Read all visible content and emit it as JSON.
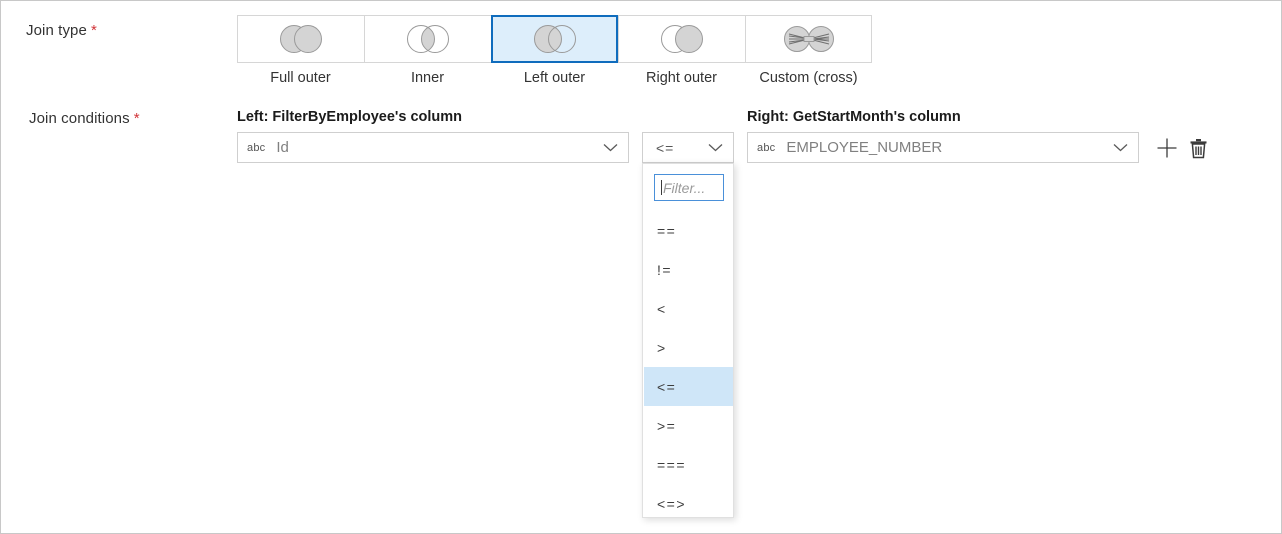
{
  "form": {
    "join_type": {
      "label": "Join type",
      "required_marker": "*",
      "options": [
        {
          "label": "Full outer",
          "icon": "venn-full-outer-icon",
          "selected": false
        },
        {
          "label": "Inner",
          "icon": "venn-inner-icon",
          "selected": false
        },
        {
          "label": "Left outer",
          "icon": "venn-left-outer-icon",
          "selected": true
        },
        {
          "label": "Right outer",
          "icon": "venn-right-outer-icon",
          "selected": false
        },
        {
          "label": "Custom (cross)",
          "icon": "venn-custom-cross-icon",
          "selected": false
        }
      ]
    },
    "join_conditions": {
      "label": "Join conditions",
      "required_marker": "*",
      "left": {
        "heading": "Left: FilterByEmployee's column",
        "type_badge": "abc",
        "value": "Id",
        "chevron": "chevron-down-icon"
      },
      "operator": {
        "value": "<=",
        "chevron": "chevron-down-icon"
      },
      "right": {
        "heading": "Right: GetStartMonth's column",
        "type_badge": "abc",
        "value": "EMPLOYEE_NUMBER",
        "chevron": "chevron-down-icon"
      },
      "actions": {
        "add": "add-icon",
        "delete": "delete-icon"
      }
    },
    "operator_dropdown": {
      "open": true,
      "filter_placeholder": "Filter...",
      "items": [
        {
          "label": "==",
          "selected": false
        },
        {
          "label": "!=",
          "selected": false
        },
        {
          "label": "<",
          "selected": false
        },
        {
          "label": ">",
          "selected": false
        },
        {
          "label": "<=",
          "selected": true
        },
        {
          "label": ">=",
          "selected": false
        },
        {
          "label": "===",
          "selected": false
        },
        {
          "label": "<=>",
          "selected": false
        }
      ]
    }
  },
  "colors": {
    "accent": "#0f6cbd",
    "selected_tile_bg": "#ddeefb",
    "highlight_row": "#cfe6f8",
    "required_star": "#d13438",
    "venn_fill": "#d4d4d4",
    "venn_stroke": "#9a9a9a"
  }
}
